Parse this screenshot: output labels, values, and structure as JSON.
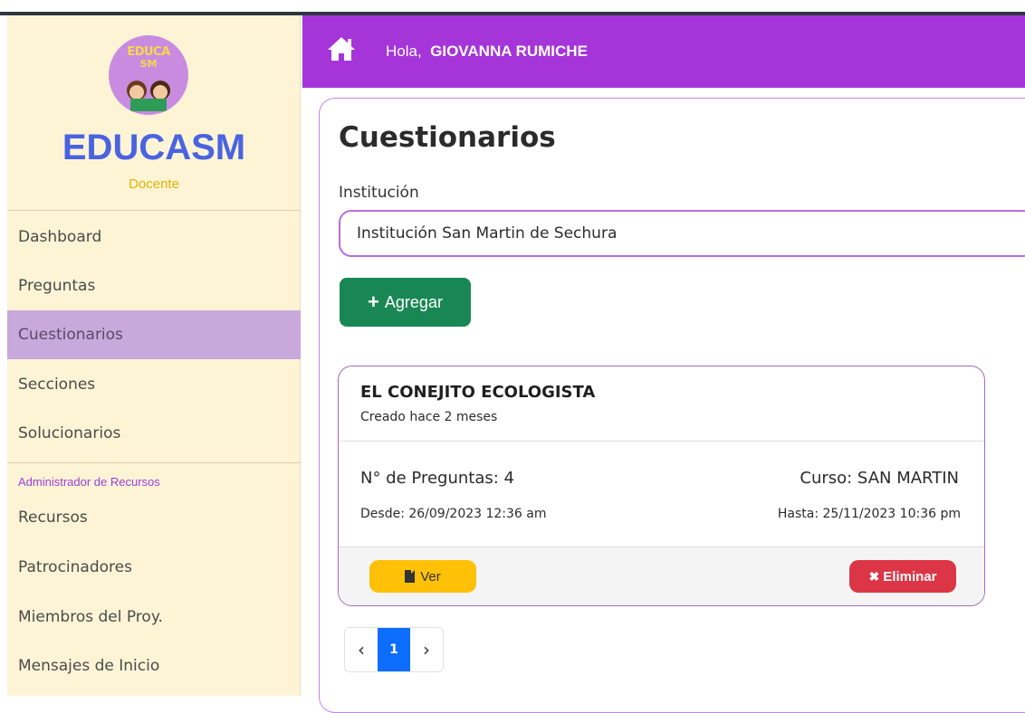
{
  "sidebar": {
    "logo_text_line1": "EDUCA",
    "logo_text_line2": "SM",
    "brand": "EDUCASM",
    "role": "Docente",
    "items": [
      {
        "label": "Dashboard"
      },
      {
        "label": "Preguntas"
      },
      {
        "label": "Cuestionarios"
      },
      {
        "label": "Secciones"
      },
      {
        "label": "Solucionarios"
      }
    ],
    "section_label": "Administrador de Recursos",
    "resource_items": [
      {
        "label": "Recursos"
      },
      {
        "label": "Patrocinadores"
      },
      {
        "label": "Miembros del Proy."
      },
      {
        "label": "Mensajes de Inicio"
      }
    ],
    "active_item": "Cuestionarios"
  },
  "header": {
    "greeting": "Hola,",
    "user_name": "GIOVANNA RUMICHE",
    "icon": "home-icon"
  },
  "main": {
    "title": "Cuestionarios",
    "institution_label": "Institución",
    "institution_value": "Institución San Martin de Sechura",
    "add_button_label": "Agregar"
  },
  "card": {
    "title": "EL CONEJITO ECOLOGISTA",
    "created": "Creado hace 2 meses",
    "num_questions": "N° de Preguntas: 4",
    "course": "Curso: SAN MARTIN",
    "from": "Desde: 26/09/2023 12:36 am",
    "to": "Hasta: 25/11/2023 10:36 pm",
    "view_label": "Ver",
    "delete_label": "Eliminar"
  },
  "pagination": {
    "prev": "‹",
    "current": "1",
    "next": "›"
  },
  "colors": {
    "header": "#a535d9",
    "sidebar": "#fdf4d6",
    "active_nav": "#c9a8dc",
    "add_button": "#198754",
    "view_button": "#ffc107",
    "delete_button": "#dc3545",
    "page_active": "#0d6efd"
  }
}
